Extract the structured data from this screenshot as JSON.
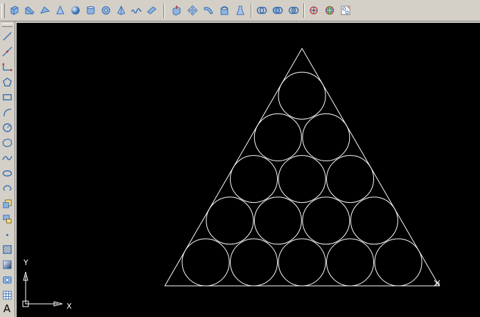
{
  "colors": {
    "canvas_bg": "#000000",
    "line": "#ffffff",
    "toolbar_bg": "#d4d0c8",
    "icon_blue": "#3a6fb0",
    "icon_red": "#c03030"
  },
  "toolbar_top": {
    "buttons": [
      "box-icon",
      "wedge-icon",
      "cone-solid-icon",
      "sphere-icon",
      "cylinder-icon",
      "torus-icon",
      "pyramid-icon",
      "helix-icon",
      "planar-surface-icon",
      "extrude-icon",
      "presspull-icon",
      "sweep-icon",
      "revolve-icon",
      "loft-icon",
      "union-icon",
      "subtract-icon",
      "intersect-icon",
      "3d-move-icon",
      "3d-rotate-icon",
      "3d-align-icon"
    ]
  },
  "toolbar_left": {
    "buttons": [
      "line-icon",
      "construction-line-icon",
      "polyline-icon",
      "polygon-icon",
      "rectangle-icon",
      "arc-icon",
      "circle-icon",
      "revision-cloud-icon",
      "spline-icon",
      "ellipse-icon",
      "ellipse-arc-icon",
      "insert-block-icon",
      "make-block-icon",
      "point-icon",
      "hatch-icon",
      "gradient-icon",
      "region-icon",
      "table-icon",
      "multiline-text-icon"
    ],
    "text_button": "A"
  },
  "ucs": {
    "x_label": "X",
    "y_label": "Y"
  }
}
